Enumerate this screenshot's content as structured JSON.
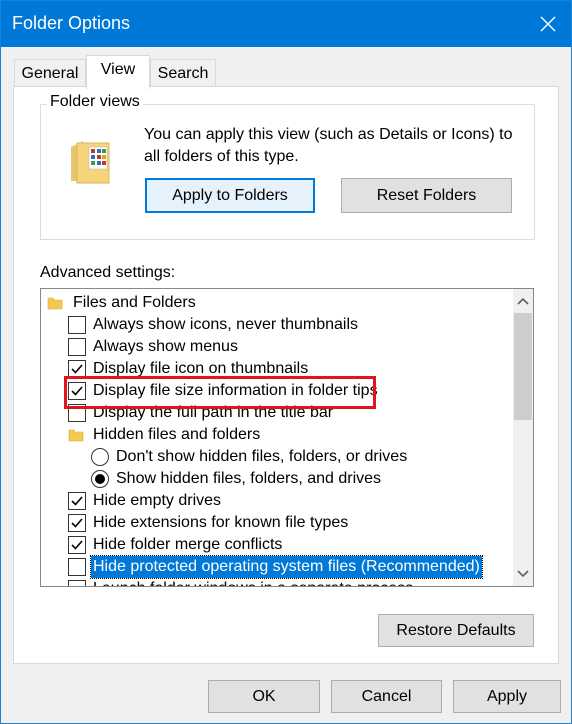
{
  "window": {
    "title": "Folder Options"
  },
  "tabs": [
    {
      "label": "General",
      "active": false
    },
    {
      "label": "View",
      "active": true
    },
    {
      "label": "Search",
      "active": false
    }
  ],
  "folder_views": {
    "label": "Folder views",
    "description": "You can apply this view (such as Details or Icons) to all folders of this type.",
    "apply_button": "Apply to Folders",
    "reset_button": "Reset Folders"
  },
  "advanced": {
    "label": "Advanced settings:",
    "items": [
      {
        "type": "folder",
        "label": "Files and Folders"
      },
      {
        "type": "checkbox",
        "label": "Always show icons, never thumbnails",
        "checked": false
      },
      {
        "type": "checkbox",
        "label": "Always show menus",
        "checked": false
      },
      {
        "type": "checkbox",
        "label": "Display file icon on thumbnails",
        "checked": true
      },
      {
        "type": "checkbox",
        "label": "Display file size information in folder tips",
        "checked": true
      },
      {
        "type": "checkbox",
        "label": "Display the full path in the title bar",
        "checked": false
      },
      {
        "type": "folder",
        "label": "Hidden files and folders"
      },
      {
        "type": "radio",
        "label": "Don't show hidden files, folders, or drives",
        "checked": false
      },
      {
        "type": "radio",
        "label": "Show hidden files, folders, and drives",
        "checked": true
      },
      {
        "type": "checkbox",
        "label": "Hide empty drives",
        "checked": true
      },
      {
        "type": "checkbox",
        "label": "Hide extensions for known file types",
        "checked": true
      },
      {
        "type": "checkbox",
        "label": "Hide folder merge conflicts",
        "checked": true
      },
      {
        "type": "checkbox",
        "label": "Hide protected operating system files (Recommended)",
        "checked": false,
        "selected": true
      },
      {
        "type": "checkbox",
        "label": "Launch folder windows in a separate process",
        "checked": false
      }
    ]
  },
  "restore_defaults": {
    "label": "Restore Defaults"
  },
  "footer": {
    "ok": "OK",
    "cancel": "Cancel",
    "apply": "Apply"
  },
  "colors": {
    "titlebar": "#0078d7",
    "selection": "#0078d7",
    "highlight_box": "#e0141e"
  },
  "icons": {
    "close": "close-icon",
    "folder": "folder-icon",
    "scroll_up": "chevron-up-icon",
    "scroll_down": "chevron-down-icon"
  }
}
